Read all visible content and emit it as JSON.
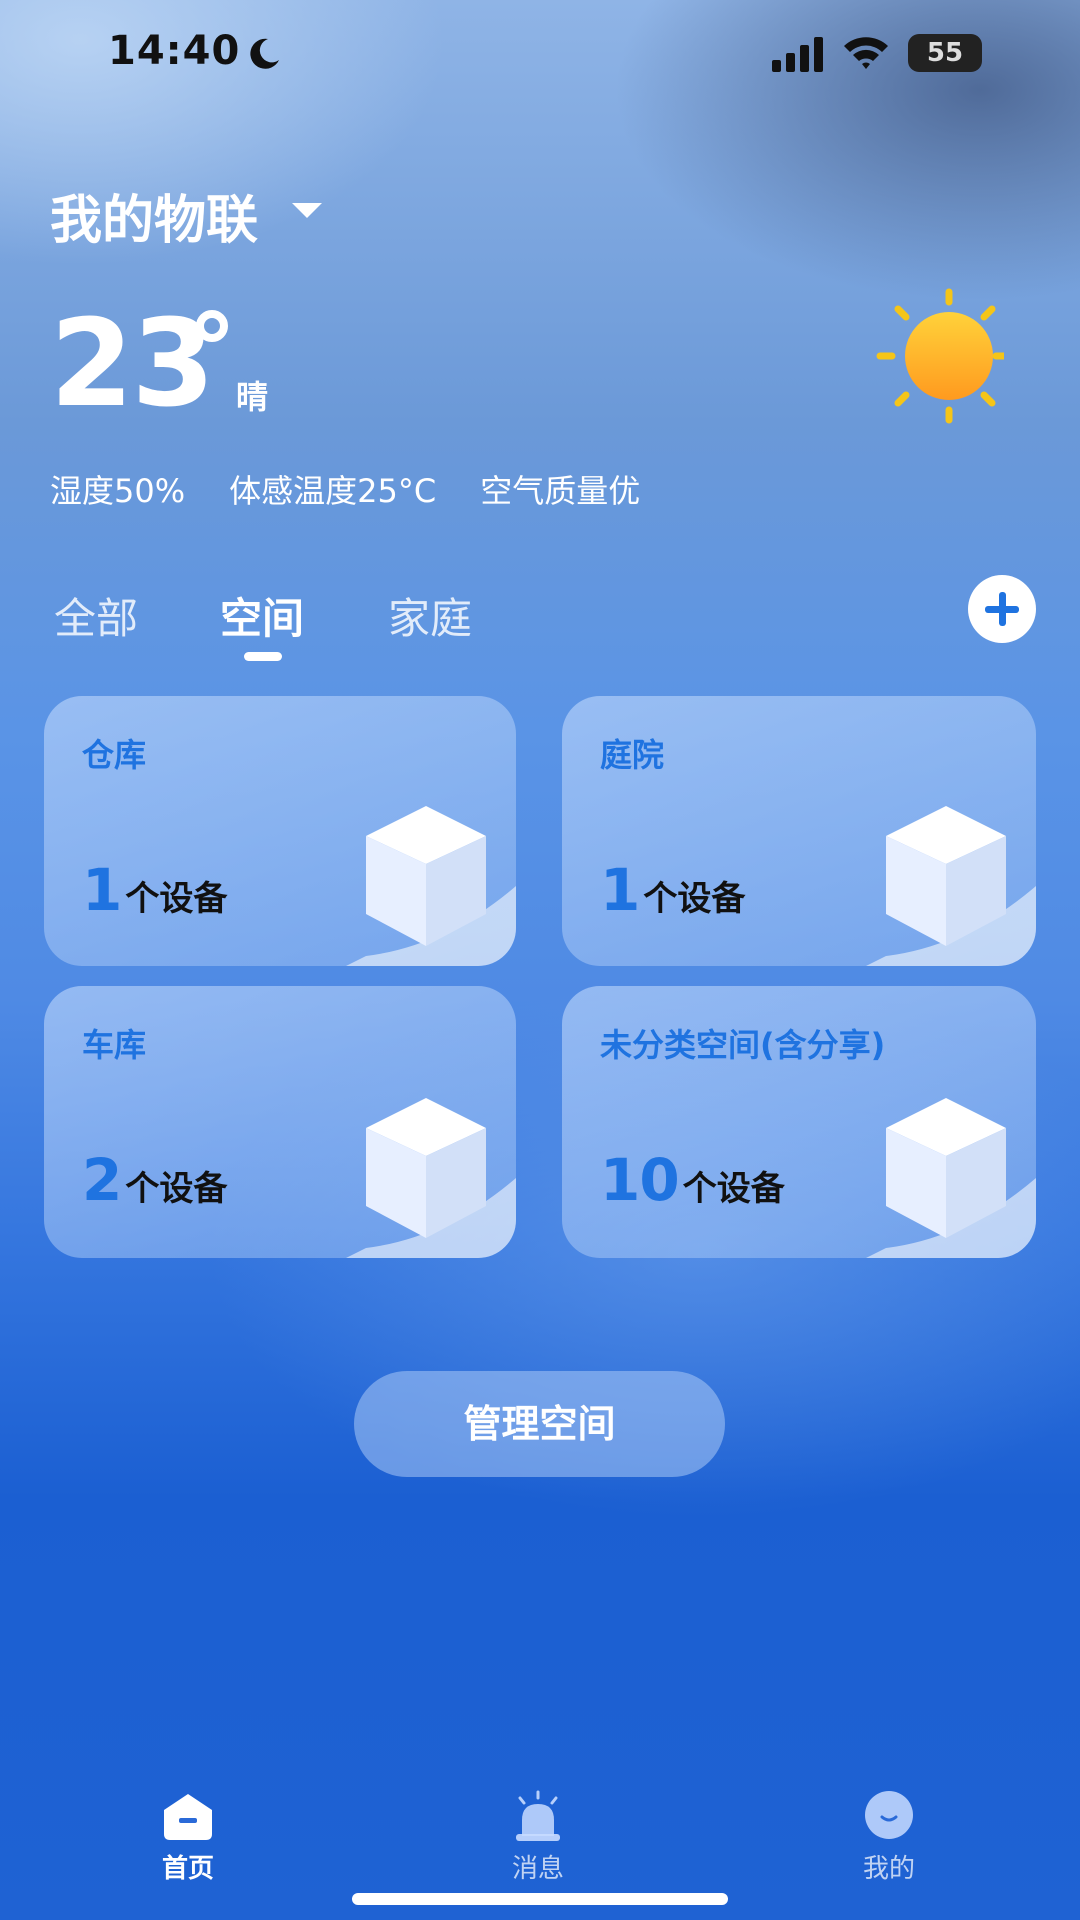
{
  "status_bar": {
    "time": "14:40",
    "battery": "55",
    "icons": [
      "moon-icon",
      "signal-icon",
      "wifi-icon",
      "battery-icon"
    ]
  },
  "header": {
    "title": "我的物联"
  },
  "weather": {
    "temperature": "23",
    "condition": "晴",
    "humidity": "湿度50%",
    "feels_like": "体感温度25°C",
    "air_quality": "空气质量优",
    "icon": "sun-icon"
  },
  "tabs": [
    {
      "label": "全部",
      "active": false
    },
    {
      "label": "空间",
      "active": true
    },
    {
      "label": "家庭",
      "active": false
    }
  ],
  "spaces": [
    {
      "name": "仓库",
      "count": "1",
      "unit": "个设备"
    },
    {
      "name": "庭院",
      "count": "1",
      "unit": "个设备"
    },
    {
      "name": "车库",
      "count": "2",
      "unit": "个设备"
    },
    {
      "name": "未分类空间(含分享)",
      "count": "10",
      "unit": "个设备"
    }
  ],
  "manage_button": "管理空间",
  "bottom_nav": [
    {
      "label": "首页",
      "icon": "home-icon",
      "active": true
    },
    {
      "label": "消息",
      "icon": "alarm-bell-icon",
      "active": false
    },
    {
      "label": "我的",
      "icon": "smiley-profile-icon",
      "active": false
    }
  ],
  "colors": {
    "accent": "#1f73e0",
    "sun": "#ffb020",
    "sun_rays": "#f5c518"
  }
}
